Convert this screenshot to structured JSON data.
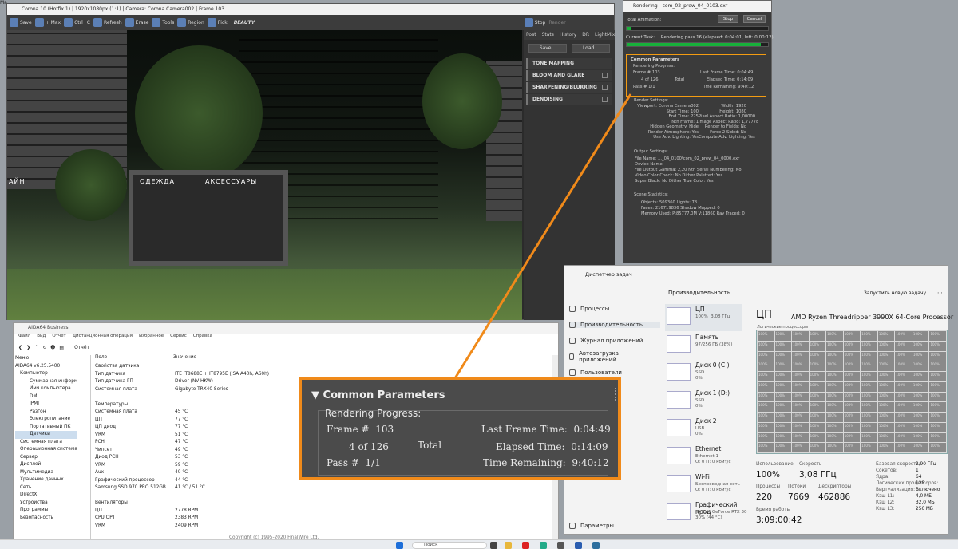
{
  "vfb": {
    "title": "Corona 10 (Hotfix 1) | 1920x1080px (1:1) | Camera: Corona Camera002 | Frame 103",
    "toolbar": [
      "Save",
      "+ Max",
      "Ctrl+C",
      "Refresh",
      "Erase",
      "Tools",
      "Region",
      "Pick"
    ],
    "channel": "BEAUTY",
    "stop": "Stop",
    "render": "Render",
    "tabs": [
      "Post",
      "Stats",
      "History",
      "DR",
      "LightMix"
    ],
    "save_btn": "Save...",
    "load_btn": "Load...",
    "sections": [
      "TONE MAPPING",
      "BLOOM AND GLARE",
      "SHARPENING/BLURRING",
      "DENOISING"
    ],
    "shop_signs": [
      "ОДЕЖДА",
      "АКСЕССУАРЫ"
    ],
    "left_sign": "АЙН"
  },
  "rendering": {
    "title": "Rendering - com_02_prew_04_0103.exr",
    "total_animation": "Total Animation:",
    "stop": "Stop",
    "cancel": "Cancel",
    "current_task": "Current Task:",
    "task_text": "Rendering pass 16 (elapsed: 0:04:01, left: 0:00:12)",
    "common": "Common Parameters",
    "progress": "Rendering Progress:",
    "frame_label": "Frame #",
    "frame": "103",
    "of": "4 of 126",
    "total": "Total",
    "pass_label": "Pass #",
    "pass": "1/1",
    "last_frame_label": "Last Frame Time:",
    "last_frame": "0:04:49",
    "elapsed_label": "Elapsed Time:",
    "elapsed": "0:14:09",
    "remaining_label": "Time Remaining:",
    "remaining": "9:40:12",
    "render_settings": "Render Settings:",
    "rs_left": [
      "Viewport: Corona Camera002",
      "Start Time: 100",
      "End Time: 225",
      "Nth Frame: 1",
      "Hidden Geometry: Hide",
      "Render Atmosphere: Yes",
      "Use Adv. Lighting: Yes"
    ],
    "rs_right": [
      "Width: 1920",
      "Height: 1080",
      "Pixel Aspect Ratio: 1,00000",
      "Image Aspect Ratio: 1,77778",
      "Render to Fields: No",
      "Force 2-Sided: No",
      "Compute Adv. Lighting: Yes"
    ],
    "output_settings": "Output Settings:",
    "os_lines": [
      "File Name: ..._04_0100\\com_02_prew_04_0000.exr",
      "Device Name:",
      "File Output Gamma: 2,20   Nth Serial Numbering: No",
      "Video Color Check: No    Dither Paletted: Yes",
      "Super Black: No          Dither True Color: Yes"
    ],
    "scene_stats": "Scene Statistics:",
    "ss_lines": [
      "Objects: 509360          Lights: 78",
      "Faces: 216719836    Shadow Mapped: 0",
      "Memory Used: P:85777,0M V:11860   Ray Traced: 0"
    ]
  },
  "aida": {
    "title": "AIDA64 Business",
    "menu": [
      "Файл",
      "Вид",
      "Отчёт",
      "Дистанционная операция",
      "Избранное",
      "Сервис",
      "Справка"
    ],
    "toolbar_label": "Отчёт",
    "col_field": "Поле",
    "col_value": "Значение",
    "tree": [
      "Меню",
      "AIDA64 v6.25.5400",
      "Компьютер",
      "Суммарная информ",
      "Имя компьютера",
      "DMI",
      "IPMI",
      "Разгон",
      "Электропитание",
      "Портативный ПК",
      "Датчики",
      "Системная плата",
      "Операционная система",
      "Сервер",
      "Дисплей",
      "Мультимедиа",
      "Хранение данных",
      "Сеть",
      "DirectX",
      "Устройства",
      "Программы",
      "Безопасность"
    ],
    "rows": [
      [
        "Свойства датчика",
        ""
      ],
      [
        "Тип датчика",
        "ITE IT8688E + IT8795E (ISA A40h, A60h)"
      ],
      [
        "Тип датчика ГП",
        "Driver (NV-HKW)"
      ],
      [
        "Системная плата",
        "Gigabyte TRX40 Series"
      ],
      [
        "",
        ""
      ],
      [
        "Температуры",
        ""
      ],
      [
        "Системная плата",
        "45 °C"
      ],
      [
        "ЦП",
        "77 °C"
      ],
      [
        "ЦП диод",
        "77 °C"
      ],
      [
        "VRM",
        "51 °C"
      ],
      [
        "PCH",
        "47 °C"
      ],
      [
        "Чипсет",
        "49 °C"
      ],
      [
        "Диод PCH",
        "53 °C"
      ],
      [
        "VRM",
        "59 °C"
      ],
      [
        "Aux",
        "40 °C"
      ],
      [
        "Графический процессор",
        "44 °C"
      ],
      [
        "Samsung SSD 970 PRO 512GB",
        "41 °C / 51 °C"
      ],
      [
        "",
        ""
      ],
      [
        "Вентиляторы",
        ""
      ],
      [
        "ЦП",
        "2778 RPM"
      ],
      [
        "CPU OPT",
        "2383 RPM"
      ],
      [
        "VRM",
        "2409 RPM"
      ]
    ],
    "copyright": "Copyright (c) 1995-2020 FinalWire Ltd."
  },
  "taskmgr": {
    "title": "Диспетчер задач",
    "header": "Производительность",
    "run_task": "Запустить новую задачу",
    "nav": [
      "Процессы",
      "Производительность",
      "Журнал приложений",
      "Автозагрузка приложений",
      "Пользователи"
    ],
    "settings": "Параметры",
    "devices": [
      {
        "name": "ЦП",
        "sub": "100%  3,08 ГГц"
      },
      {
        "name": "Память",
        "sub": "97/256 ГБ (38%)"
      },
      {
        "name": "Диск 0 (C:)",
        "sub": "SSD\n0%"
      },
      {
        "name": "Диск 1 (D:)",
        "sub": "SSD\n0%"
      },
      {
        "name": "Диск 2",
        "sub": "USB\n0%"
      },
      {
        "name": "Ethernet",
        "sub": "Ethernet 1\nО: 0 П: 0 кбит/с"
      },
      {
        "name": "Wi-Fi",
        "sub": "Беспроводная сеть\nО: 0 П: 0 кбит/с"
      },
      {
        "name": "Графический проц",
        "sub": "NVIDIA GeForce RTX 30\n30% (44 °C)"
      }
    ],
    "cpu_title": "ЦП",
    "cpu_model": "AMD Ryzen Threadripper 3990X 64-Core Processor",
    "grid_label": "Логические процессоры",
    "cell": "100%",
    "util_label": "Использование",
    "util": "100%",
    "speed_label": "Скорость",
    "speed": "3,08 ГГц",
    "proc_label": "Процессы",
    "proc": "220",
    "threads_label": "Потоки",
    "threads": "7669",
    "handles_label": "Дескрипторы",
    "handles": "462886",
    "uptime_label": "Время работы",
    "uptime": "3:09:00:42",
    "right_stats": [
      [
        "Базовая скорость:",
        "2,90 ГГц"
      ],
      [
        "Сокетов:",
        "1"
      ],
      [
        "Ядра:",
        "64"
      ],
      [
        "Логических процессоров:",
        "128"
      ],
      [
        "Виртуализация:",
        "Включено"
      ],
      [
        "Кэш L1:",
        "4,0 МБ"
      ],
      [
        "Кэш L2:",
        "32,0 МБ"
      ],
      [
        "Кэш L3:",
        "256 МБ"
      ]
    ]
  },
  "zoom": {
    "title": "Common Parameters",
    "progress": "Rendering Progress:",
    "frame_label": "Frame #",
    "frame": "103",
    "of": "4 of 126",
    "total": "Total",
    "pass_label": "Pass #",
    "pass": "1/1",
    "last_frame_label": "Last Frame Time:",
    "last_frame": "0:04:49",
    "elapsed_label": "Elapsed Time:",
    "elapsed": "0:14:09",
    "remaining_label": "Time Remaining:",
    "remaining": "9:40:12"
  },
  "taskbar": {
    "search": "Поиск",
    "corner": "Ma"
  },
  "colors": {
    "accent": "#f08a1a",
    "progress": "#17b13a"
  }
}
